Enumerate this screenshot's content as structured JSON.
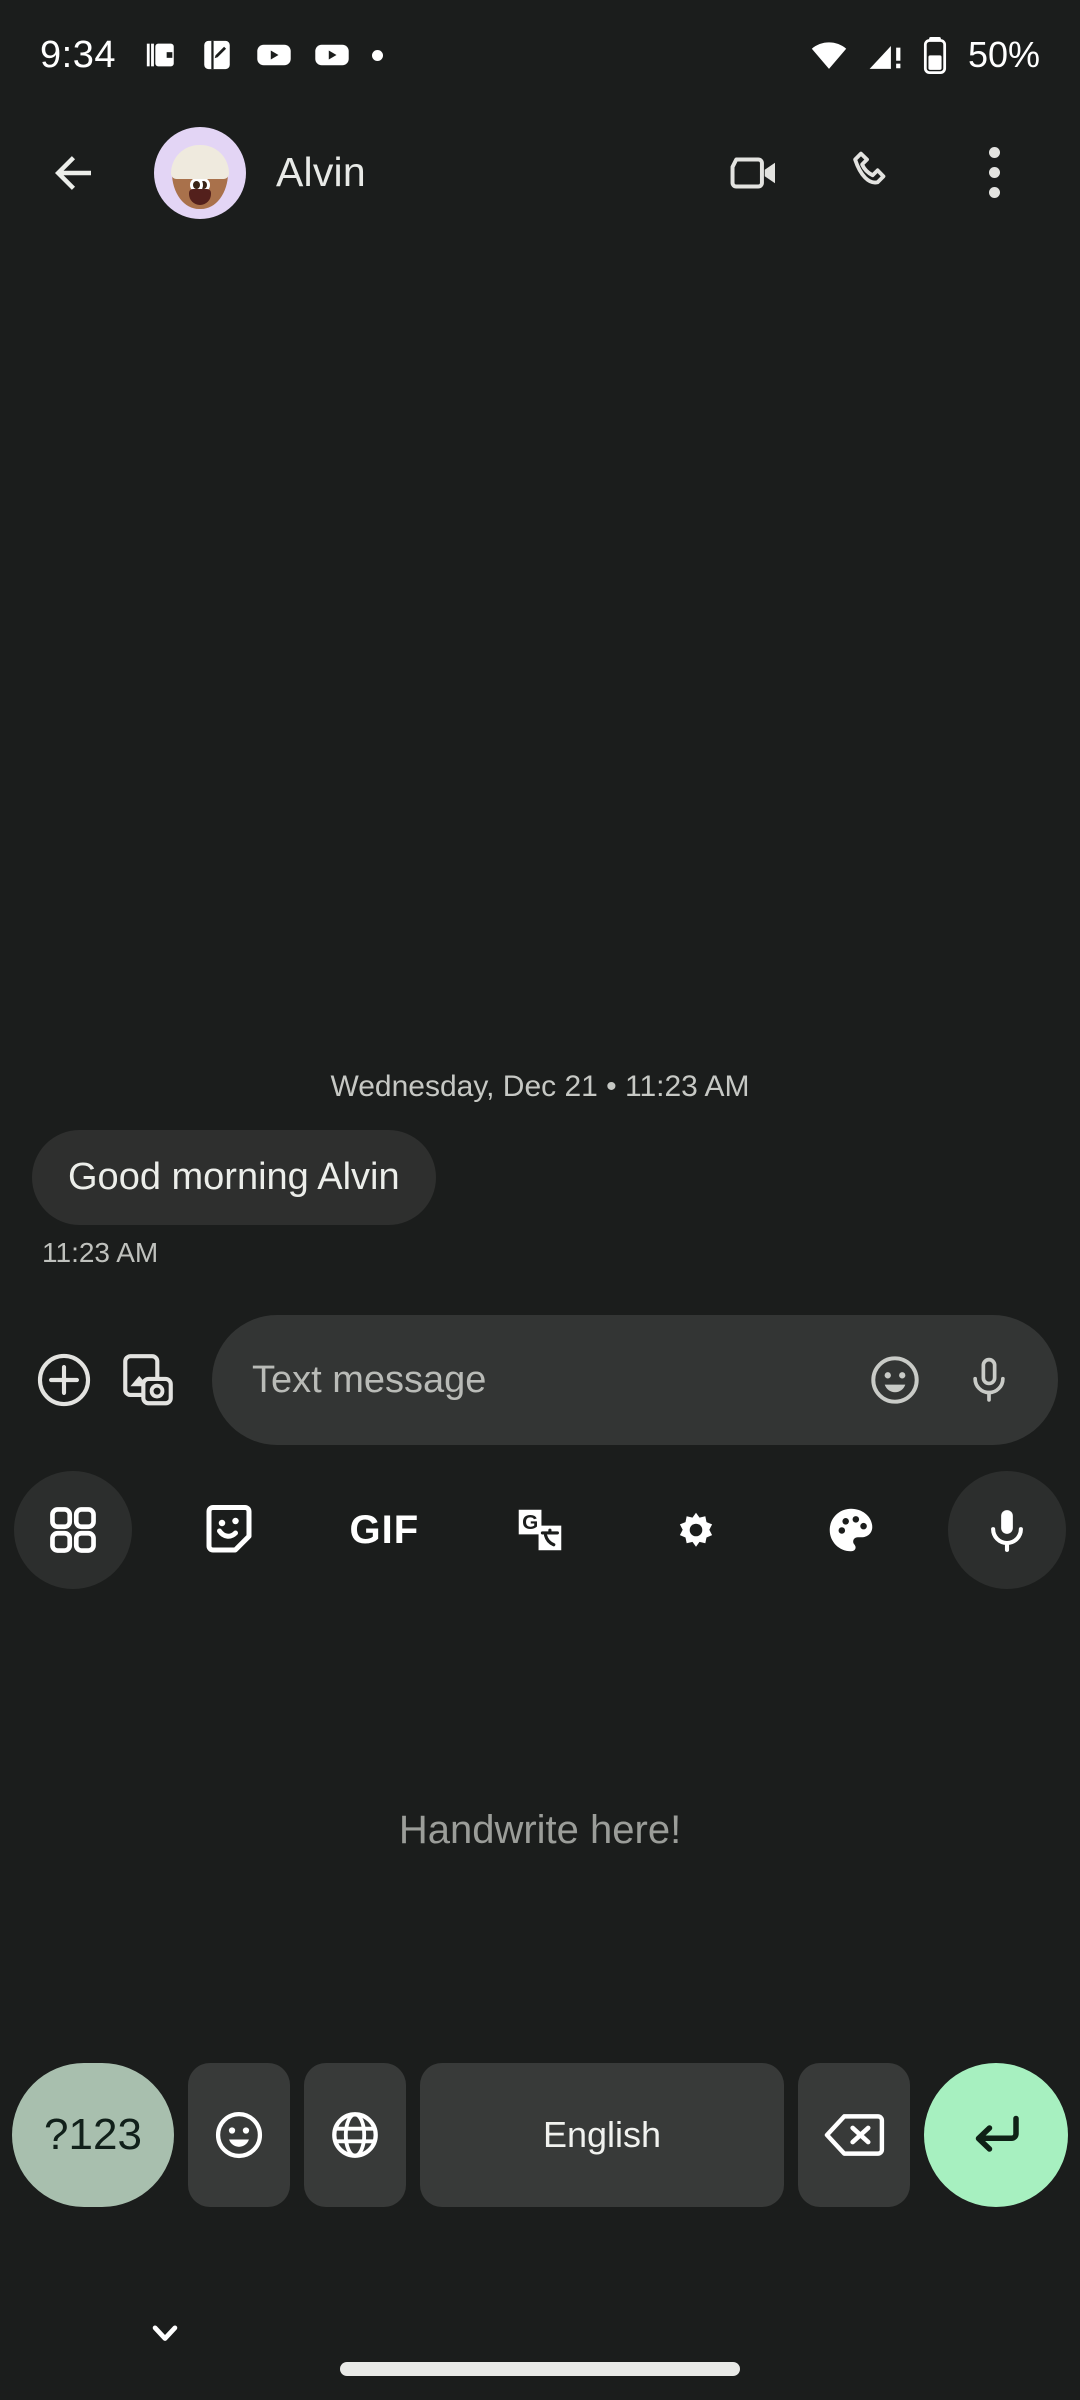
{
  "status_bar": {
    "time": "9:34",
    "battery_text": "50%",
    "left_icons": [
      "wallet-icon",
      "note-edit-icon",
      "youtube-icon",
      "youtube-music-icon",
      "more-notifications-dot"
    ],
    "right_icons": [
      "wifi-icon",
      "cellular-signal-alert-icon",
      "battery-icon"
    ]
  },
  "app_bar": {
    "back_icon": "back-arrow-icon",
    "avatar": {
      "name": "avatar-alvin",
      "background_color": "#e3d5f5"
    },
    "contact_name": "Alvin",
    "actions": [
      {
        "name": "video-call-button",
        "icon": "video-camera-icon"
      },
      {
        "name": "voice-call-button",
        "icon": "phone-icon"
      },
      {
        "name": "overflow-menu-button",
        "icon": "more-vertical-icon"
      }
    ]
  },
  "conversation": {
    "date_separator": "Wednesday, Dec 21 • 11:23 AM",
    "messages": [
      {
        "text": "Good morning Alvin",
        "timestamp": "11:23 AM",
        "direction": "incoming",
        "bubble_color": "#2e2f2e"
      }
    ]
  },
  "compose_bar": {
    "add_button_icon": "plus-circle-icon",
    "gallery_button_icon": "image-camera-icon",
    "input_placeholder": "Text message",
    "input_value": "",
    "emoji_icon": "emoji-smiley-icon",
    "mic_icon": "microphone-icon"
  },
  "keyboard_toolbar": {
    "items": [
      {
        "name": "toolbar-apps-grid",
        "icon": "grid-four-squares-icon",
        "label": "",
        "active": true
      },
      {
        "name": "toolbar-stickers",
        "icon": "sticker-smiley-icon",
        "label": ""
      },
      {
        "name": "toolbar-gif",
        "icon": "gif-text-icon",
        "label": "GIF"
      },
      {
        "name": "toolbar-translate",
        "icon": "google-translate-icon",
        "label": ""
      },
      {
        "name": "toolbar-settings",
        "icon": "gear-icon",
        "label": ""
      },
      {
        "name": "toolbar-theme",
        "icon": "palette-icon",
        "label": ""
      },
      {
        "name": "toolbar-voice-input",
        "icon": "microphone-icon",
        "label": "",
        "active": true
      }
    ]
  },
  "handwriting_pad": {
    "hint": "Handwrite here!"
  },
  "key_row": {
    "symbols_key": "?123",
    "symbols_key_color": "#a8bfae",
    "emoji_key_icon": "emoji-smiley-icon",
    "language_key_icon": "globe-icon",
    "space_key_label": "English",
    "backspace_key_icon": "backspace-icon",
    "enter_key_icon": "enter-return-icon",
    "enter_key_color": "#a7f0c0"
  },
  "nav_bar": {
    "hide_keyboard_icon": "chevron-down-icon",
    "home_indicator": "home-gesture-bar"
  }
}
